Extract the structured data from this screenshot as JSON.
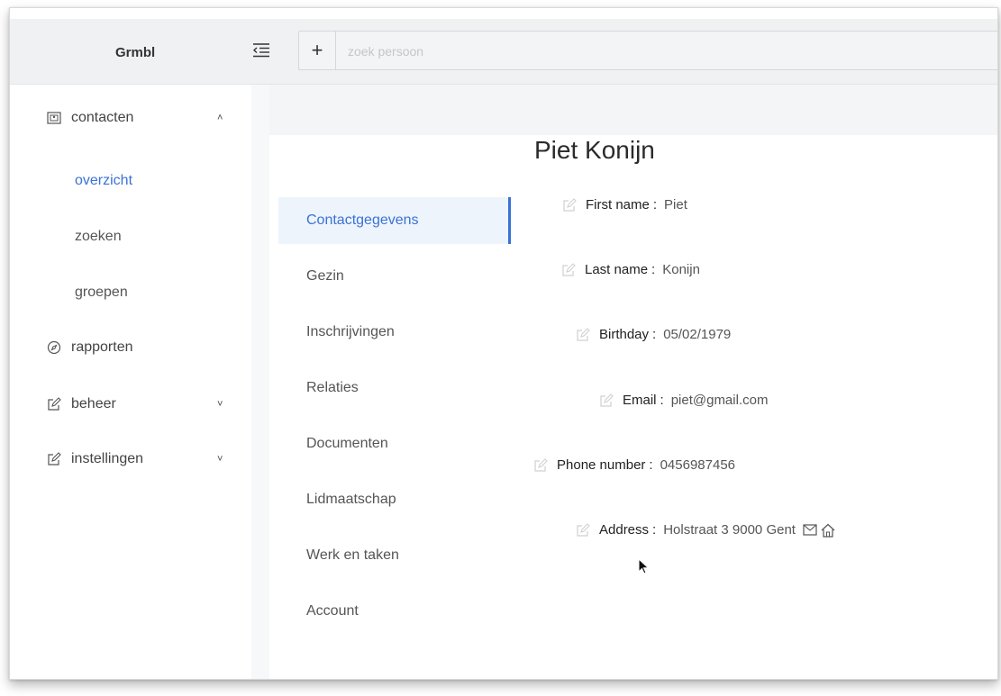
{
  "app": {
    "title": "Grmbl"
  },
  "search": {
    "placeholder": "zoek persoon",
    "add_label": "+"
  },
  "sidebar": {
    "items": [
      {
        "label": "contacten",
        "icon": "contacts-card-icon",
        "chevron": "˄"
      },
      {
        "label": "rapporten",
        "icon": "compass-icon"
      },
      {
        "label": "beheer",
        "icon": "edit-square-icon",
        "chevron": "˅"
      },
      {
        "label": "instellingen",
        "icon": "edit-square-icon",
        "chevron": "˅"
      }
    ],
    "sub_items": [
      {
        "label": "overzicht",
        "active": true
      },
      {
        "label": "zoeken"
      },
      {
        "label": "groepen"
      }
    ]
  },
  "person": {
    "name": "Piet Konijn"
  },
  "tabs": [
    {
      "label": "Contactgegevens",
      "active": true
    },
    {
      "label": "Gezin"
    },
    {
      "label": "Inschrijvingen"
    },
    {
      "label": "Relaties"
    },
    {
      "label": "Documenten"
    },
    {
      "label": "Lidmaatschap"
    },
    {
      "label": "Werk en taken"
    },
    {
      "label": "Account"
    }
  ],
  "fields": [
    {
      "label": "First name",
      "value": "Piet"
    },
    {
      "label": "Last name",
      "value": "Konijn"
    },
    {
      "label": "Birthday",
      "value": "05/02/1979"
    },
    {
      "label": "Email",
      "value": "piet@gmail.com"
    },
    {
      "label": "Phone number",
      "value": "0456987456"
    },
    {
      "label": "Address",
      "value": "Holstraat 3 9000 Gent",
      "icons": [
        "mail-icon",
        "home-icon"
      ]
    }
  ],
  "colors": {
    "accent": "#3a72d6",
    "active_tab_bg": "#eef4fc",
    "topbar_bg": "#f0f1f3"
  }
}
